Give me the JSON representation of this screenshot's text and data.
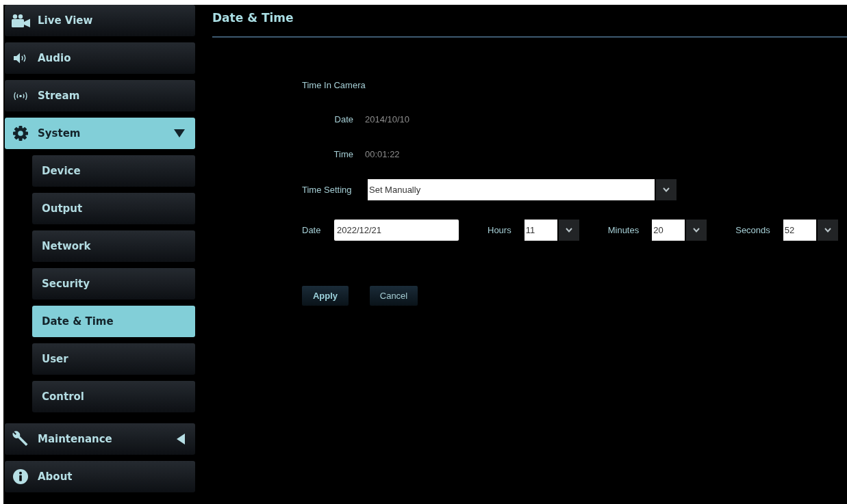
{
  "sidebar": {
    "items": [
      {
        "label": "Live View",
        "selected": false
      },
      {
        "label": "Audio",
        "selected": false
      },
      {
        "label": "Stream",
        "selected": false
      },
      {
        "label": "System",
        "selected": true,
        "expanded": true,
        "children": [
          {
            "label": "Device",
            "selected": false
          },
          {
            "label": "Output",
            "selected": false
          },
          {
            "label": "Network",
            "selected": false
          },
          {
            "label": "Security",
            "selected": false
          },
          {
            "label": "Date & Time",
            "selected": true
          },
          {
            "label": "User",
            "selected": false
          },
          {
            "label": "Control",
            "selected": false
          }
        ]
      },
      {
        "label": "Maintenance",
        "selected": false,
        "expanded": false
      },
      {
        "label": "About",
        "selected": false
      }
    ]
  },
  "page": {
    "title": "Date & Time"
  },
  "time_in_camera": {
    "heading": "Time In Camera",
    "fields": [
      {
        "label": "Date",
        "value": "2014/10/10"
      },
      {
        "label": "Time",
        "value": "00:01:22"
      }
    ]
  },
  "time_setting": {
    "label": "Time Setting",
    "value": "Set Manually"
  },
  "manual_time": {
    "date": {
      "label": "Date",
      "value": "2022/12/21"
    },
    "selects": [
      {
        "label": "Hours",
        "value": "11"
      },
      {
        "label": "Minutes",
        "value": "20"
      },
      {
        "label": "Seconds",
        "value": "52"
      }
    ]
  },
  "buttons": [
    {
      "label": "Apply",
      "kind": "primary"
    },
    {
      "label": "Cancel",
      "kind": "secondary"
    }
  ]
}
